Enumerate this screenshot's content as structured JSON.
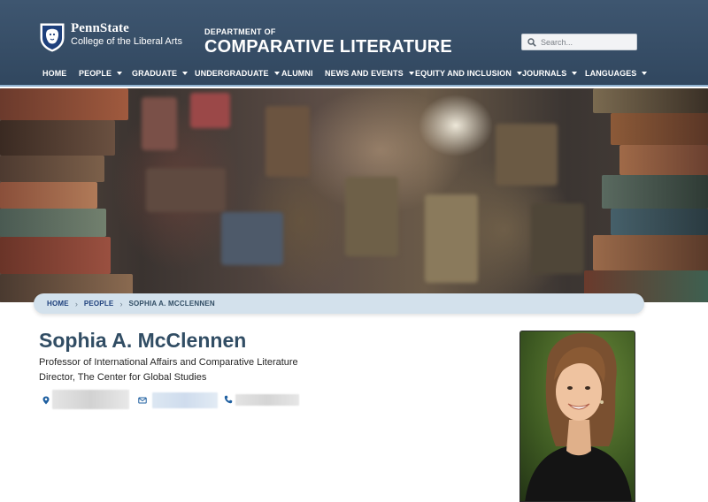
{
  "header": {
    "logo_university": "PennState",
    "logo_college": "College of the Liberal Arts",
    "dept_small": "DEPARTMENT OF",
    "dept_name": "COMPARATIVE LITERATURE",
    "search_placeholder": "Search..."
  },
  "nav": [
    {
      "label": "HOME",
      "dropdown": false
    },
    {
      "label": "PEOPLE",
      "dropdown": true
    },
    {
      "label": "GRADUATE",
      "dropdown": true
    },
    {
      "label": "UNDERGRADUATE",
      "dropdown": true
    },
    {
      "label": "ALUMNI",
      "dropdown": false
    },
    {
      "label": "NEWS AND EVENTS",
      "dropdown": true
    },
    {
      "label": "EQUITY AND INCLUSION",
      "dropdown": true
    },
    {
      "label": "JOURNALS",
      "dropdown": true
    },
    {
      "label": "LANGUAGES",
      "dropdown": true
    }
  ],
  "breadcrumb": {
    "home": "HOME",
    "people": "PEOPLE",
    "current": "SOPHIA A. MCCLENNEN"
  },
  "profile": {
    "name": "Sophia A. McClennen",
    "title_1": "Professor of International Affairs and Comparative Literature",
    "title_2": "Director, The Center for Global Studies"
  },
  "colors": {
    "header_bg": "#3e5670",
    "name_color": "#314d64",
    "breadcrumb_bg": "#d3e1ec",
    "link_color": "#1e407c"
  }
}
